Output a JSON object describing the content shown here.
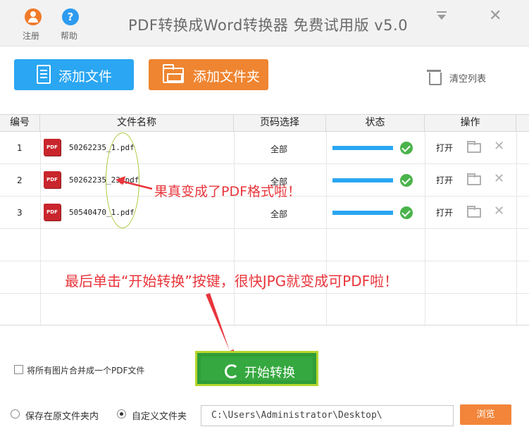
{
  "titlebar": {
    "register_label": "注册",
    "help_label": "帮助",
    "help_glyph": "?",
    "title": "PDF转换成Word转换器 免费试用版 v5.0",
    "close_glyph": "✕"
  },
  "toolbar": {
    "add_file_label": "添加文件",
    "add_folder_label": "添加文件夹",
    "clear_list_label": "清空列表"
  },
  "table": {
    "columns": [
      "编号",
      "文件名称",
      "页码选择",
      "状态",
      "操作"
    ],
    "rows": [
      {
        "index": "1",
        "icon_text": "PDF",
        "filename": "50262235_1.pdf",
        "pages": "全部",
        "progress": 1.0,
        "open": "打开"
      },
      {
        "index": "2",
        "icon_text": "PDF",
        "filename": "50262235_23.pdf",
        "pages": "全部",
        "progress": 1.0,
        "open": "打开"
      },
      {
        "index": "3",
        "icon_text": "PDF",
        "filename": "50540470_1.pdf",
        "pages": "全部",
        "progress": 1.0,
        "open": "打开"
      }
    ],
    "delete_glyph": "✕"
  },
  "annotations": {
    "note1": "果真变成了PDF格式啦！",
    "note2": "最后单击“开始转换”按键，很快JPG就变成可PDF啦！"
  },
  "bottom": {
    "merge_label": "将所有图片合并成一个PDF文件",
    "merge_checked": false,
    "start_label": "开始转换",
    "save_original_label": "保存在原文件夹内",
    "custom_folder_label": "自定义文件夹",
    "selected_option": "custom",
    "path_value": "C:\\Users\\Administrator\\Desktop\\",
    "browse_label": "浏览"
  },
  "colors": {
    "blue_button": "#2aa6f2",
    "orange_button": "#ef8531",
    "start_green": "#35a83f",
    "annotation_red": "#e8353b"
  }
}
